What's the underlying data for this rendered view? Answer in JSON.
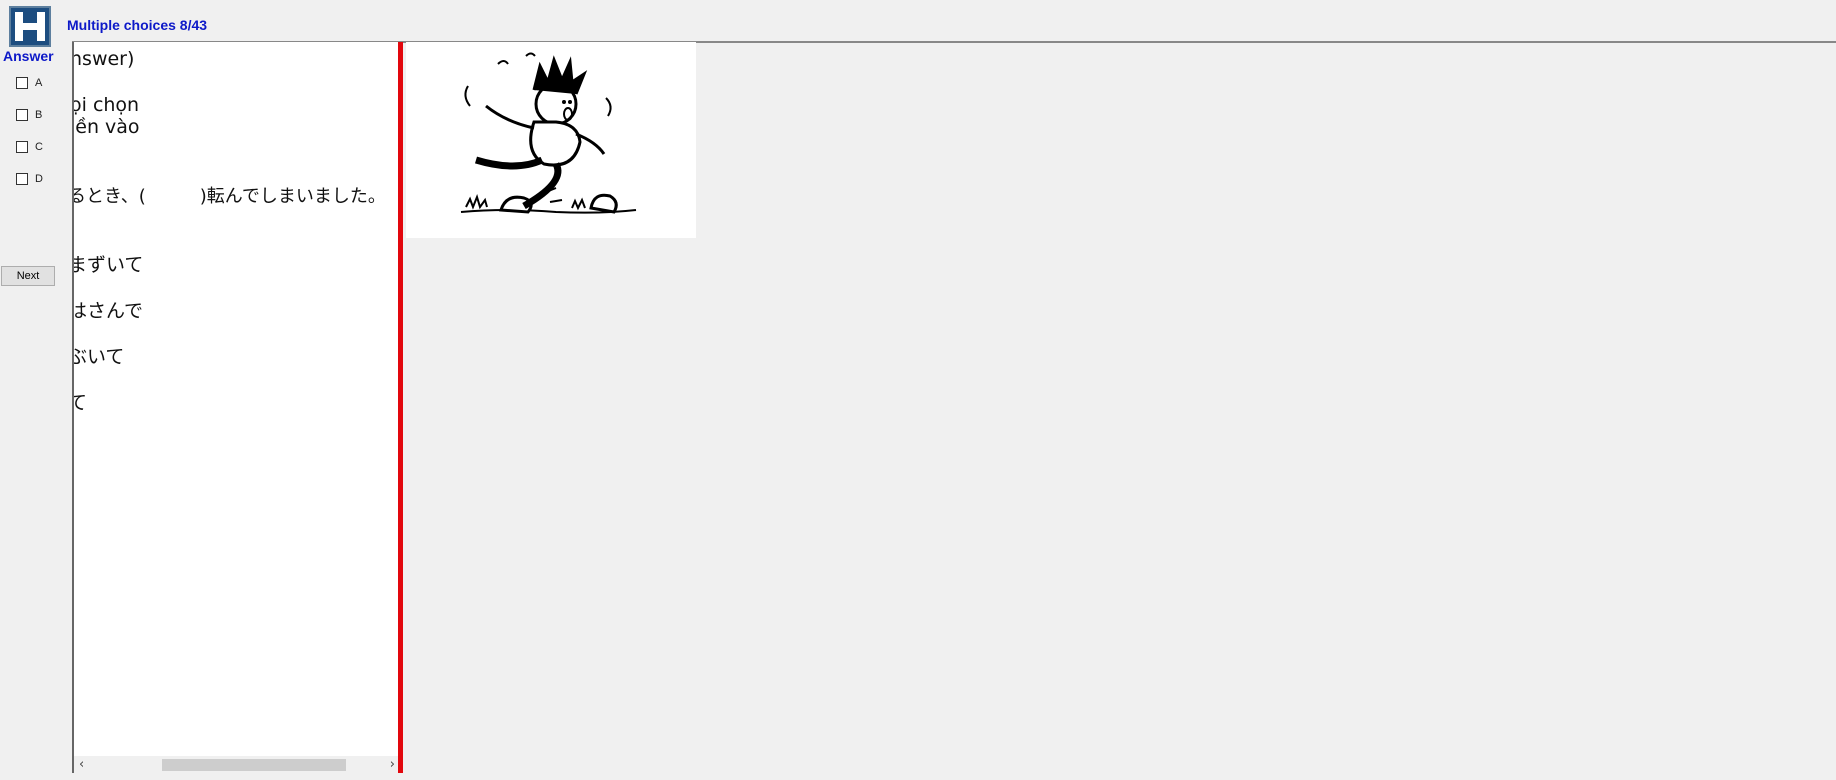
{
  "header": {
    "title": "Multiple choices 8/43"
  },
  "sidebar": {
    "answer_heading": "Answer",
    "choices": [
      {
        "label": "A",
        "checked": false
      },
      {
        "label": "B",
        "checked": false
      },
      {
        "label": "C",
        "checked": false
      },
      {
        "label": "D",
        "checked": false
      }
    ],
    "next_label": "Next"
  },
  "question": {
    "line1": "nswer)",
    "line2": "ọi chọn",
    "line3": "iền vào",
    "sentence": "るとき、(　　　)転んでしまいました。",
    "options": [
      "まずいて",
      "はさんで",
      "ぶいて",
      "て"
    ]
  },
  "colors": {
    "title": "#0d19c8",
    "divider": "#e2070d"
  },
  "icons": {
    "logo": "app-logo-icon",
    "scroll_left": "chevron-left-icon",
    "scroll_right": "chevron-right-icon"
  }
}
